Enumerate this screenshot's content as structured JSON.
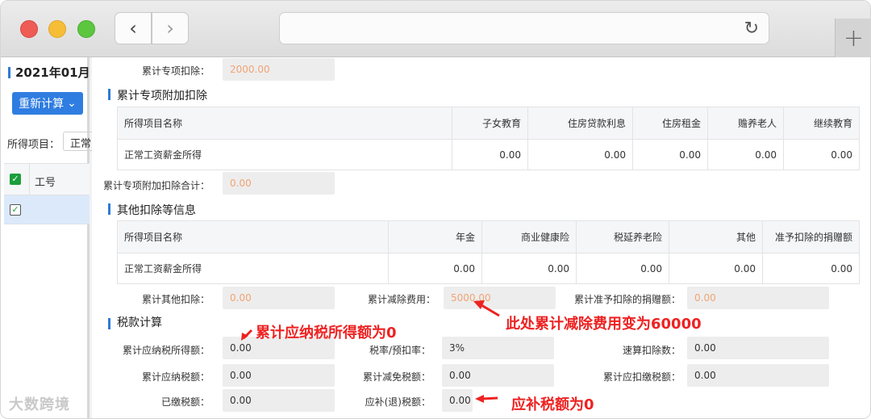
{
  "browser": {
    "back_glyph": "‹",
    "forward_glyph": "›",
    "reload_glyph": "↻",
    "newtab_glyph": "+"
  },
  "left": {
    "month": "2021年01月",
    "recalc_label": "重新计算",
    "recalc_caret": "⌄",
    "item_label": "所得项目：",
    "item_value": "正常",
    "table_header": "工号",
    "check_mark": "✓"
  },
  "main": {
    "top_field": {
      "label": "累计专项扣除：",
      "value": "2000.00"
    },
    "sec_special": {
      "title": "累计专项附加扣除",
      "headers": [
        "所得项目名称",
        "子女教育",
        "住房贷款利息",
        "住房租金",
        "赡养老人",
        "继续教育"
      ],
      "row": [
        "正常工资薪金所得",
        "0.00",
        "0.00",
        "0.00",
        "0.00",
        "0.00"
      ],
      "total_label": "累计专项附加扣除合计：",
      "total_value": "0.00"
    },
    "sec_other": {
      "title": "其他扣除等信息",
      "headers": [
        "所得项目名称",
        "年金",
        "商业健康险",
        "税延养老险",
        "其他",
        "准予扣除的捐赠额"
      ],
      "row": [
        "正常工资薪金所得",
        "0.00",
        "0.00",
        "0.00",
        "0.00",
        "0.00"
      ],
      "fields": [
        {
          "label": "累计其他扣除：",
          "value": "0.00"
        },
        {
          "label": "累计减除费用：",
          "value": "5000.00"
        },
        {
          "label": "累计准予扣除的捐赠额：",
          "value": "0.00"
        }
      ]
    },
    "sec_tax": {
      "title": "税款计算",
      "fields": {
        "taxable_income": {
          "label": "累计应纳税所得额：",
          "value": "0.00"
        },
        "tax_rate": {
          "label": "税率/预扣率：",
          "value": "3%"
        },
        "quick_deduction": {
          "label": "速算扣除数：",
          "value": "0.00"
        },
        "tax_payable": {
          "label": "累计应纳税额：",
          "value": "0.00"
        },
        "tax_relief": {
          "label": "累计减免税额：",
          "value": "0.00"
        },
        "withheld": {
          "label": "累计应扣缴税额：",
          "value": "0.00"
        },
        "paid": {
          "label": "已缴税额：",
          "value": "0.00"
        },
        "refund": {
          "label": "应补(退)税额：",
          "value": "0.00"
        }
      }
    }
  },
  "annotations": {
    "a1": "累计应纳税所得额为0",
    "a2": "此处累计减除费用变为60000",
    "a3": "应补税额为0"
  },
  "watermark": "大数跨境",
  "colors": {
    "accent": "#2f7de1",
    "annotation": "#ee2222",
    "orange_value": "#f0a473"
  }
}
